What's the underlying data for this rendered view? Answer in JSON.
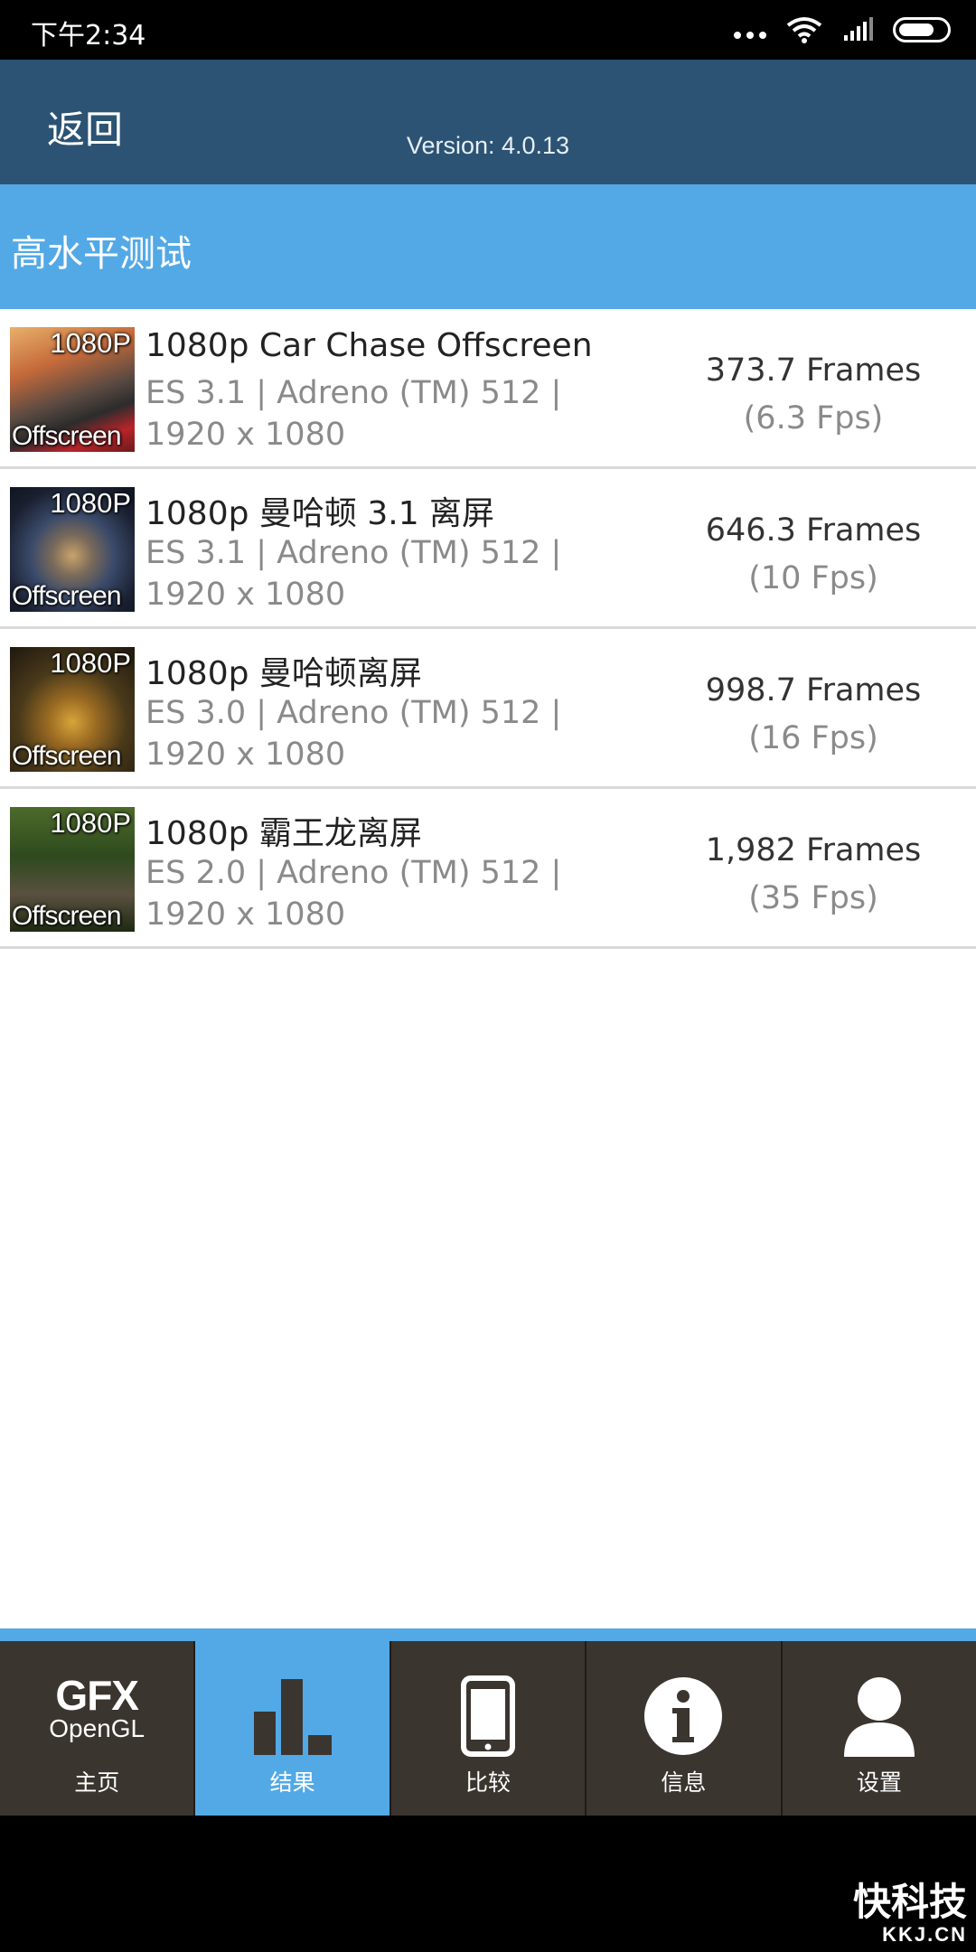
{
  "status_bar": {
    "time": "下午2:34"
  },
  "header": {
    "back_label": "返回",
    "version": "Version: 4.0.13"
  },
  "section": {
    "title": "高水平测试"
  },
  "tests": [
    {
      "badge_top": "1080P",
      "badge_bottom": "Offscreen",
      "name": "1080p Car Chase Offscreen",
      "detail_line1": "ES 3.1 | Adreno (TM) 512 |",
      "detail_line2": "1920 x 1080",
      "frames": "373.7 Frames",
      "fps": "(6.3 Fps)"
    },
    {
      "badge_top": "1080P",
      "badge_bottom": "Offscreen",
      "name": "1080p 曼哈顿 3.1 离屏",
      "detail_line1": "ES 3.1 | Adreno (TM) 512 |",
      "detail_line2": "1920 x 1080",
      "frames": "646.3 Frames",
      "fps": "(10 Fps)"
    },
    {
      "badge_top": "1080P",
      "badge_bottom": "Offscreen",
      "name": "1080p 曼哈顿离屏",
      "detail_line1": "ES 3.0 | Adreno (TM) 512 |",
      "detail_line2": "1920 x 1080",
      "frames": "998.7 Frames",
      "fps": "(16 Fps)"
    },
    {
      "badge_top": "1080P",
      "badge_bottom": "Offscreen",
      "name": "1080p 霸王龙离屏",
      "detail_line1": "ES 2.0 | Adreno (TM) 512 |",
      "detail_line2": "1920 x 1080",
      "frames": "1,982 Frames",
      "fps": "(35 Fps)"
    }
  ],
  "nav": {
    "home": {
      "logo_top": "GFX",
      "logo_bottom": "OpenGL",
      "label": "主页"
    },
    "results": {
      "label": "结果",
      "active": true
    },
    "compare": {
      "label": "比较"
    },
    "info": {
      "label": "信息"
    },
    "settings": {
      "label": "设置"
    }
  },
  "watermark": {
    "cn": "快科技",
    "en": "KKJ.CN"
  },
  "colors": {
    "header": "#2c5373",
    "accent": "#53a9e6",
    "nav_bg": "#3b3530"
  }
}
